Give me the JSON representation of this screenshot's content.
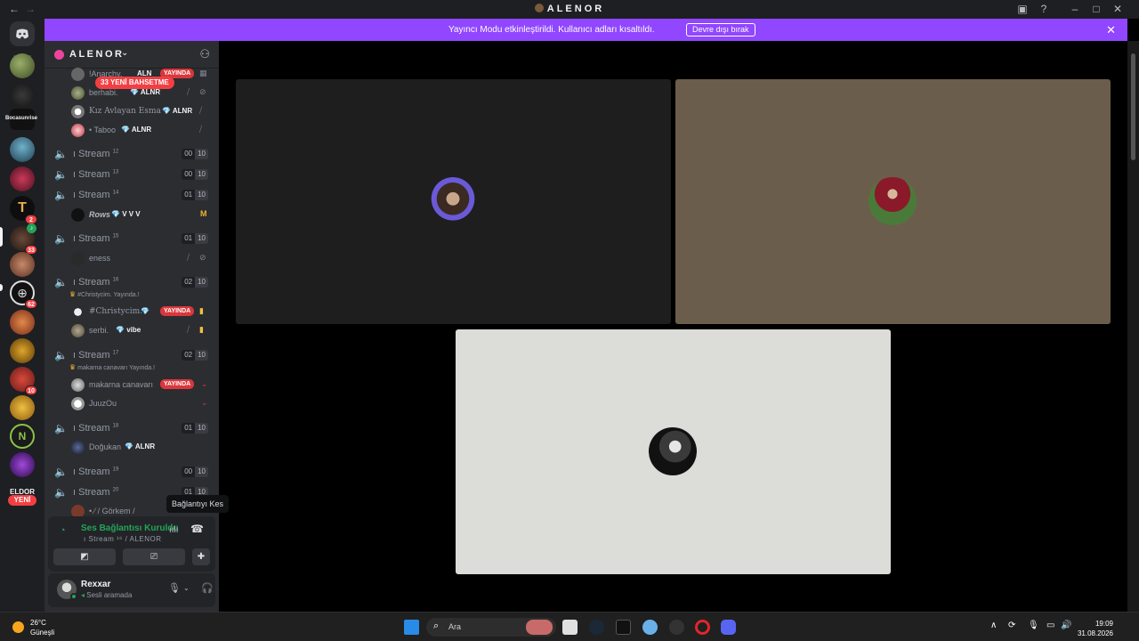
{
  "window": {
    "title": "ALENOR",
    "back": "←",
    "forward": "→"
  },
  "banner": {
    "text": "Yayıncı Modu etkinleştirildi. Kullanıcı adları kısaltıldı.",
    "button": "Devre dışı bırak",
    "close": "✕"
  },
  "rail": {
    "badges": {
      "t": "2",
      "a33": "33",
      "hb": "62",
      "red": "10"
    },
    "texts": {
      "bocasunrise": "Bocasunrise",
      "eldor": "ELDOR"
    },
    "new_label": "YENİ"
  },
  "guild": {
    "name": "ALENOR",
    "mention_pill": "33 YENİ BAHSETME"
  },
  "channels": [
    {
      "name": "Stream",
      "num": "12",
      "count": "00",
      "limit": "10"
    },
    {
      "name": "Stream",
      "num": "13",
      "count": "00",
      "limit": "10"
    },
    {
      "name": "Stream",
      "num": "14",
      "count": "01",
      "limit": "10"
    },
    {
      "name": "Stream",
      "num": "15",
      "count": "01",
      "limit": "10"
    },
    {
      "name": "Stream",
      "num": "16",
      "count": "02",
      "limit": "10"
    },
    {
      "name": "Stream",
      "num": "17",
      "count": "02",
      "limit": "10"
    },
    {
      "name": "Stream",
      "num": "18",
      "count": "01",
      "limit": "10"
    },
    {
      "name": "Stream",
      "num": "19",
      "count": "00",
      "limit": "10"
    },
    {
      "name": "Stream",
      "num": "20",
      "count": "01",
      "limit": "10"
    }
  ],
  "statuses": {
    "s16": "#Christycim. Yayında.!",
    "s17": "makarna canavarı Yayında.!"
  },
  "users": {
    "anarchy": {
      "name": "!Anarchy.",
      "tag": "ALN",
      "live": "YAYINDA"
    },
    "berhabi": {
      "name": "berhabi.",
      "tag": "ALNR"
    },
    "kiz": {
      "name": "Kız Avlayan Esma",
      "tag": "ALNR"
    },
    "taboo": {
      "name": "• Taboo",
      "tag": "ALNR"
    },
    "rows": {
      "name": "Rows",
      "tag": "V V V"
    },
    "eness": {
      "name": "eness"
    },
    "christy": {
      "name": "#Christycim.",
      "live": "YAYINDA"
    },
    "serbi": {
      "name": "serbi.",
      "tag": "vibe"
    },
    "makarna": {
      "name": "makarna canavarı",
      "live": "YAYINDA"
    },
    "juuz": {
      "name": "JuuzOu"
    },
    "dogukan": {
      "name": "Doğukan",
      "tag": "ALNR"
    },
    "gorkem": {
      "name": "• ⁄ ﻿/ Görkem /"
    }
  },
  "tooltip": "Bağlantıyı Kes",
  "voice": {
    "title": "Ses Bağlantısı Kuruldu",
    "subtitle": "ı Stream ¹⁶ / ALENOR"
  },
  "user": {
    "name": "Rexxar",
    "status": "Sesli aramada"
  },
  "colors": {
    "banner": "#9146ff",
    "live": "#da373c",
    "connected": "#23a559",
    "tile1": "#1e1e1e",
    "tile2": "#6b5d4b",
    "tile3": "#dcdcd8"
  },
  "taskbar": {
    "weather_temp": "26°C",
    "weather_desc": "Güneşli",
    "search_placeholder": "Ara",
    "time": "19:09",
    "date": "31.08.2026"
  }
}
